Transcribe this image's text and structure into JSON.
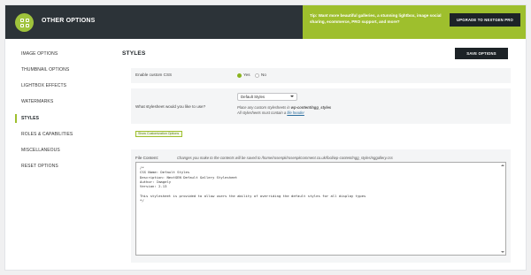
{
  "header": {
    "title": "OTHER OPTIONS",
    "promo_text": "Tip: Want more beautiful galleries, a stunning lightbox, image social sharing, ecommerce, PRO support, and more?",
    "promo_button": "UPGRADE TO NEXTGEN PRO"
  },
  "sidebar": {
    "items": [
      {
        "label": "IMAGE OPTIONS"
      },
      {
        "label": "THUMBNAIL OPTIONS"
      },
      {
        "label": "LIGHTBOX EFFECTS"
      },
      {
        "label": "WATERMARKS"
      },
      {
        "label": "STYLES"
      },
      {
        "label": "ROLES & CAPABILITIES"
      },
      {
        "label": "MISCELLANEOUS"
      },
      {
        "label": "RESET OPTIONS"
      }
    ]
  },
  "main": {
    "section_title": "STYLES",
    "save_button": "SAVE OPTIONS",
    "enable_css": {
      "label": "Enable custom CSS",
      "yes_label": "Yes",
      "no_label": "No",
      "selected": "Yes"
    },
    "stylesheet": {
      "label": "What stylesheet would you like to use?",
      "selected": "Default Styles",
      "hint1_prefix": "Place any custom stylesheets in ",
      "hint1_path": "wp-content/ngg_styles",
      "hint2_prefix": "All stylesheets must contain a ",
      "hint2_link": "file header"
    },
    "show_link": "Show Customization Options",
    "file_content": {
      "label": "File Content:",
      "note": "Changes you make to the contents will be saved to /home/rosenpk/rosenpkcomment.co.uk/fool/wp-content/ngg_styles/nggallery.css",
      "lines": [
        "/*",
        "CSS Name: Default Styles",
        "Description: NextGEN Default Gallery Stylesheet",
        "Author: Imagely",
        "Version: 2.13",
        "",
        "This stylesheet is provided to allow users the ability of overriding the default styles for all display types",
        "*/"
      ]
    }
  }
}
